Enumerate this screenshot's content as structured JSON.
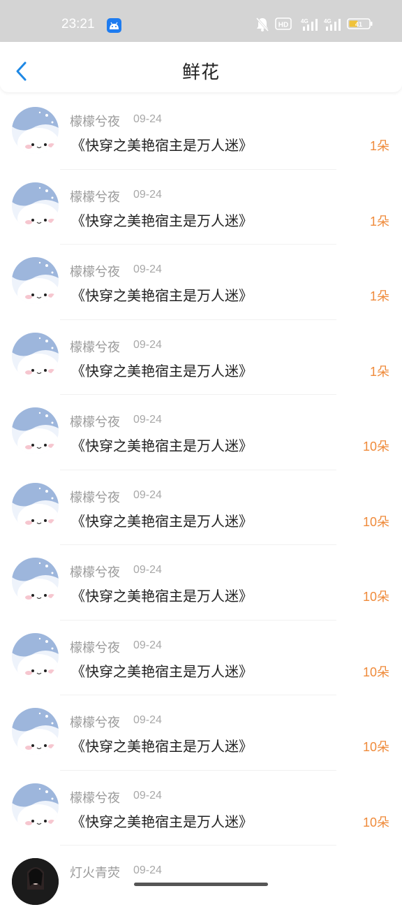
{
  "status_bar": {
    "time": "23:21",
    "icons": [
      "android-app-icon",
      "bell-muted-icon",
      "hd-icon",
      "signal-4g-icon",
      "signal-4g-icon",
      "battery-icon"
    ],
    "hd_label": "HD",
    "sig_label_1": "4G",
    "sig_label_2": "4G",
    "battery_level": "41"
  },
  "header": {
    "title": "鲜花",
    "back_icon": "chevron-left-icon"
  },
  "list": [
    {
      "name": "檬檬兮夜",
      "date": "09-24",
      "book": "《快穿之美艳宿主是万人迷》",
      "count": "1朵"
    },
    {
      "name": "檬檬兮夜",
      "date": "09-24",
      "book": "《快穿之美艳宿主是万人迷》",
      "count": "1朵"
    },
    {
      "name": "檬檬兮夜",
      "date": "09-24",
      "book": "《快穿之美艳宿主是万人迷》",
      "count": "1朵"
    },
    {
      "name": "檬檬兮夜",
      "date": "09-24",
      "book": "《快穿之美艳宿主是万人迷》",
      "count": "1朵"
    },
    {
      "name": "檬檬兮夜",
      "date": "09-24",
      "book": "《快穿之美艳宿主是万人迷》",
      "count": "10朵"
    },
    {
      "name": "檬檬兮夜",
      "date": "09-24",
      "book": "《快穿之美艳宿主是万人迷》",
      "count": "10朵"
    },
    {
      "name": "檬檬兮夜",
      "date": "09-24",
      "book": "《快穿之美艳宿主是万人迷》",
      "count": "10朵"
    },
    {
      "name": "檬檬兮夜",
      "date": "09-24",
      "book": "《快穿之美艳宿主是万人迷》",
      "count": "10朵"
    },
    {
      "name": "檬檬兮夜",
      "date": "09-24",
      "book": "《快穿之美艳宿主是万人迷》",
      "count": "10朵"
    },
    {
      "name": "檬檬兮夜",
      "date": "09-24",
      "book": "《快穿之美艳宿主是万人迷》",
      "count": "10朵"
    }
  ],
  "partial_row": {
    "name": "灯火青荧",
    "date": "09-24"
  },
  "colors": {
    "accent": "#1e88e5",
    "count": "#ef8a3a",
    "status_bar": "#d4d4d4"
  }
}
